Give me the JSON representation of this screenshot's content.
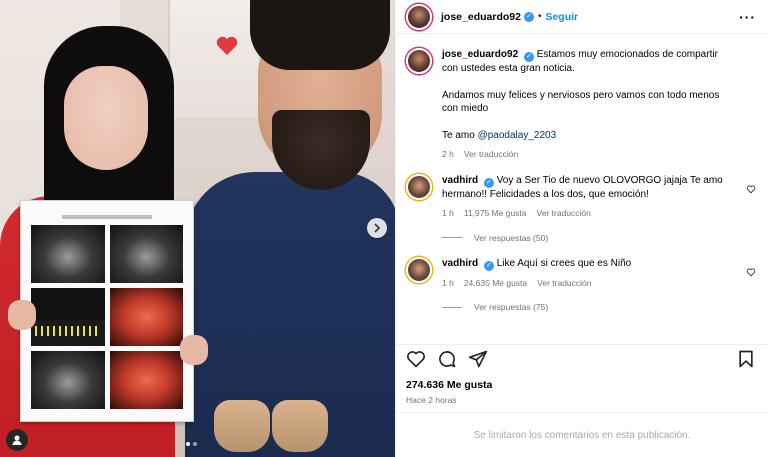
{
  "post": {
    "author": "jose_eduardo92",
    "follow_label": "Seguir",
    "separator": "•"
  },
  "photo": {
    "carousel_dots": 2,
    "active_dot": 0
  },
  "caption": {
    "username": "jose_eduardo92",
    "line1": "Estamos muy emocionados de compartir con ustedes esta gran noticia.",
    "line2": "Andamos muy felices y nerviosos pero vamos con todo menos con miedo",
    "line3_prefix": "Te amo ",
    "mention": "@paodalay_2203",
    "age": "2 h",
    "translate": "Ver traducción"
  },
  "comments": [
    {
      "username": "vadhird",
      "text": "Voy a Ser Tio de nuevo OLOVORGO jajaja Te amo hermano!! Felicidades a los dos, que emoción!",
      "age": "1 h",
      "likes": "11,975 Me gusta",
      "translate": "Ver traducción",
      "replies": "Ver respuestas (50)"
    },
    {
      "username": "vadhird",
      "text": "Like Aquí si crees que es Niño",
      "age": "1 h",
      "likes": "24,635 Me gusta",
      "translate": "Ver traducción",
      "replies": "Ver respuestas (75)"
    }
  ],
  "stats": {
    "likes": "274.636 Me gusta",
    "time": "Hace 2 horas"
  },
  "footer": {
    "limited": "Se limitaron los comentarios en esta publicación."
  },
  "colors": {
    "accent": "#0095f6",
    "verified": "#3897f0",
    "muted": "#737373",
    "mention": "#00376b"
  },
  "icons": [
    "heart-icon",
    "comment-icon",
    "share-icon",
    "bookmark-icon",
    "more-options-icon",
    "verified-icon",
    "user-tag-icon",
    "chevron-right-icon"
  ]
}
